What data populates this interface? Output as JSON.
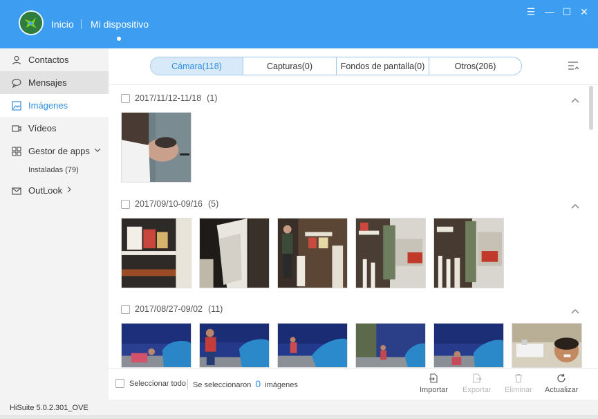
{
  "header": {
    "nav_home": "Inicio",
    "nav_device": "Mi dispositivo",
    "accent": "#3d9df0",
    "window_buttons": {
      "menu": "☰",
      "minimize": "—",
      "maximize": "☐",
      "close": "✕"
    }
  },
  "sidebar": {
    "items": [
      {
        "label": "Contactos",
        "icon": "user-icon"
      },
      {
        "label": "Mensajes",
        "icon": "message-icon"
      },
      {
        "label": "Imágenes",
        "icon": "image-icon"
      },
      {
        "label": "Vídeos",
        "icon": "video-icon"
      },
      {
        "label": "Gestor de apps",
        "icon": "apps-icon"
      },
      {
        "label": "OutLook",
        "icon": "mail-icon"
      }
    ],
    "sub_installed": "Instaladas (79)"
  },
  "tabs": [
    {
      "label": "Cámara(118)"
    },
    {
      "label": "Capturas(0)"
    },
    {
      "label": "Fondos de pantalla(0)"
    },
    {
      "label": "Otros(206)"
    }
  ],
  "groups": [
    {
      "date": "2017/11/12-11/18",
      "count": "(1)"
    },
    {
      "date": "2017/09/10-09/16",
      "count": "(5)"
    },
    {
      "date": "2017/08/27-09/02",
      "count": "(11)"
    }
  ],
  "bottom": {
    "select_all": "Seleccionar todo",
    "selected_prefix": "Se seleccionaron",
    "selected_count": "0",
    "selected_suffix": "imágenes",
    "actions": {
      "import": "Importar",
      "export": "Exportar",
      "delete": "Eliminar",
      "refresh": "Actualizar"
    }
  },
  "status": {
    "version": "HiSuite 5.0.2.301_OVE"
  }
}
